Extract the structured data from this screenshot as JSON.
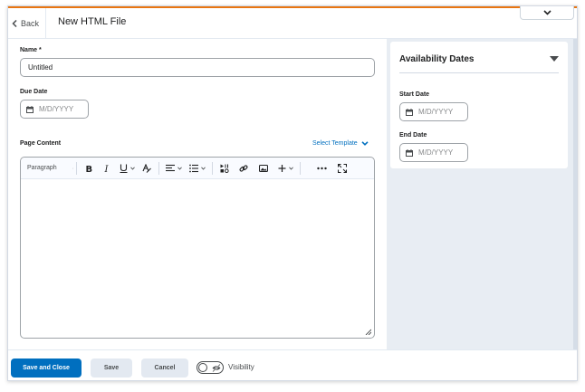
{
  "header": {
    "back_label": "Back",
    "title": "New HTML File"
  },
  "form": {
    "name_label": "Name *",
    "name_value": "Untitled",
    "due_date_label": "Due Date",
    "date_placeholder": "M/D/YYYY",
    "page_content_label": "Page Content",
    "select_template_label": "Select Template"
  },
  "editor": {
    "block_format": "Paragraph",
    "toolbar_icons": [
      "bold-icon",
      "italic-icon",
      "underline-icon",
      "strikethrough-icon",
      "align-icon",
      "list-icon",
      "media-icon",
      "link-icon",
      "image-icon",
      "insert-icon",
      "more-icon",
      "fullscreen-icon"
    ]
  },
  "sidebar": {
    "title": "Availability Dates",
    "start_date_label": "Start Date",
    "end_date_label": "End Date",
    "date_placeholder": "M/D/YYYY"
  },
  "footer": {
    "save_close_label": "Save and Close",
    "save_label": "Save",
    "cancel_label": "Cancel",
    "visibility_label": "Visibility"
  },
  "colors": {
    "accent": "#e87511",
    "primary": "#006fbf",
    "link": "#006fbf",
    "sidebar_bg": "#e8edf3"
  }
}
